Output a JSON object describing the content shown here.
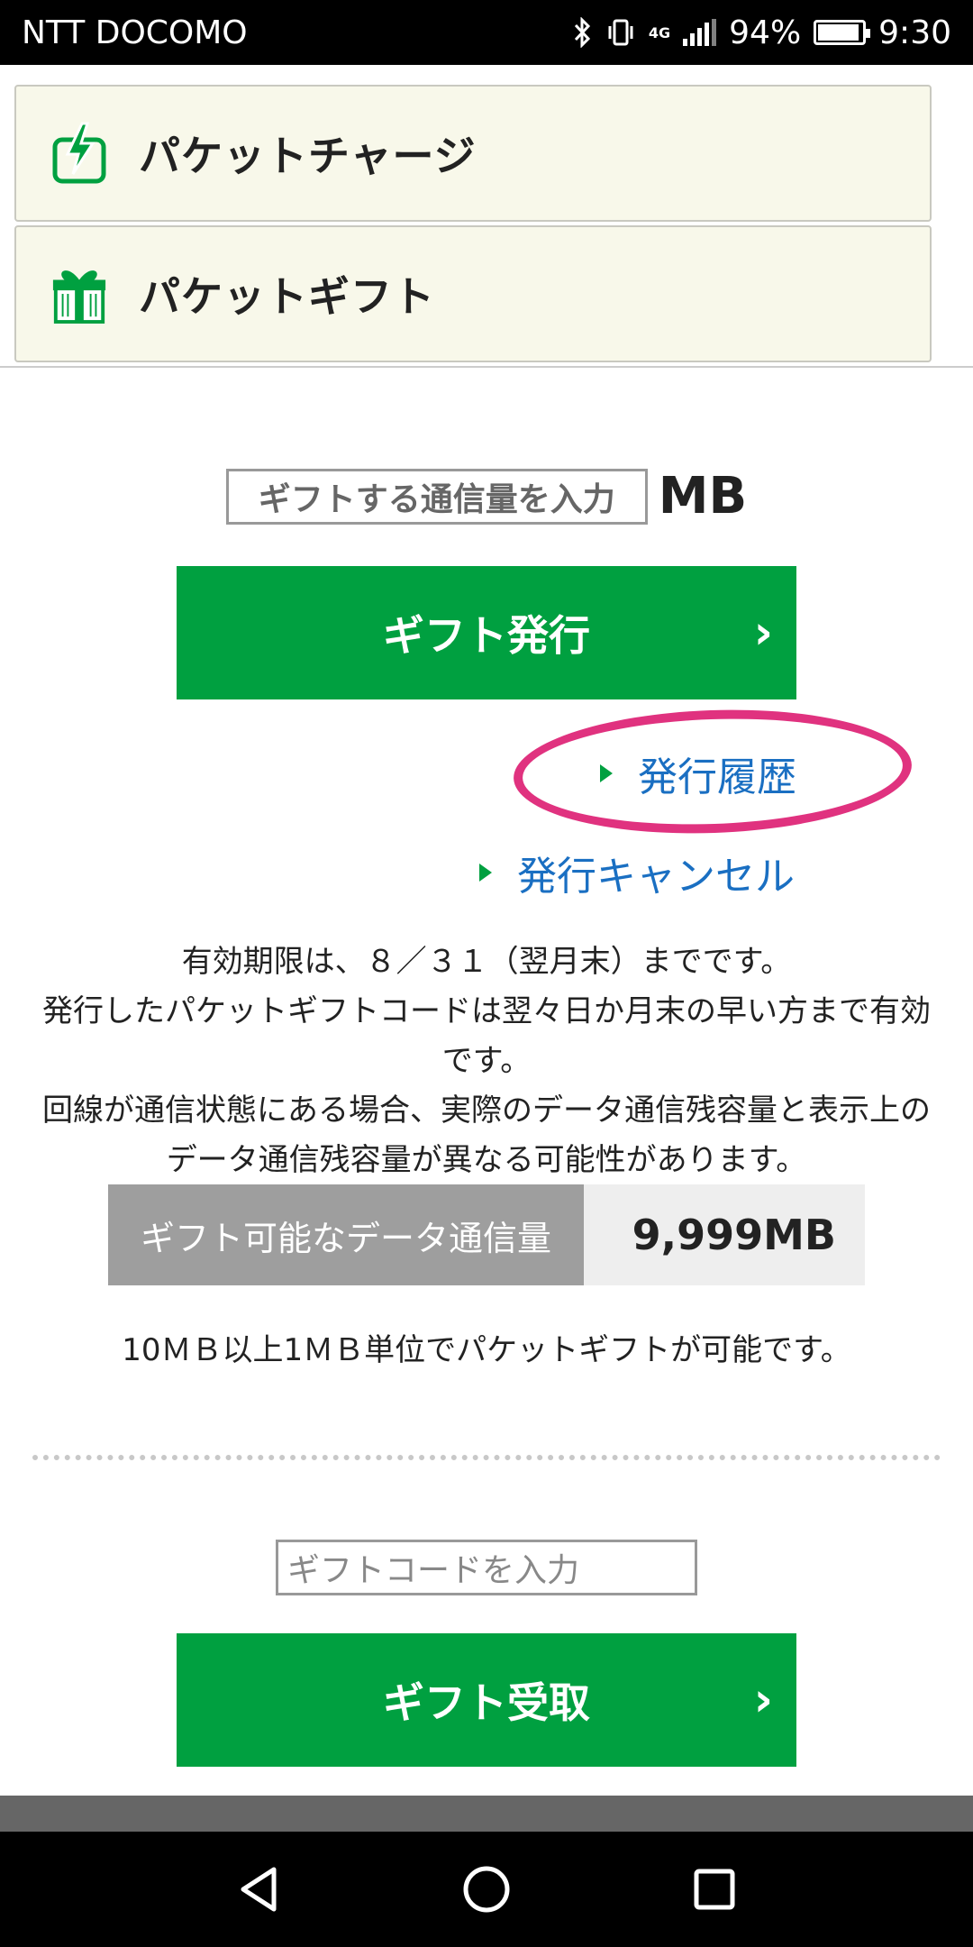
{
  "status_bar": {
    "carrier": "NTT DOCOMO",
    "battery_percent": "94%",
    "battery_level": 0.94,
    "time": "9:30",
    "network": "4G"
  },
  "menu": {
    "charge_label": "パケットチャージ",
    "gift_label": "パケットギフト"
  },
  "gift_issue": {
    "amount_placeholder": "ギフトする通信量を入力",
    "unit": "MB",
    "issue_button": "ギフト発行",
    "history_link": "発行履歴",
    "cancel_link": "発行キャンセル"
  },
  "notes": {
    "line1": "有効期限は、８／３１（翌月末）までです。",
    "line2": "発行したパケットギフトコードは翌々日か月末の早い方まで有効です。",
    "line3": "回線が通信状態にある場合、実際のデータ通信残容量と表示上のデータ通信残容量が異なる可能性があります。"
  },
  "giftable": {
    "label": "ギフト可能なデータ通信量",
    "value": "9,999MB"
  },
  "unit_note": "10ＭＢ以上1ＭＢ単位でパケットギフトが可能です。",
  "gift_receive": {
    "code_placeholder": "ギフトコードを入力",
    "receive_button": "ギフト受取"
  },
  "colors": {
    "accent_green": "#00a040",
    "link_blue": "#1a6fc2",
    "annotation_pink": "#e0327f"
  }
}
